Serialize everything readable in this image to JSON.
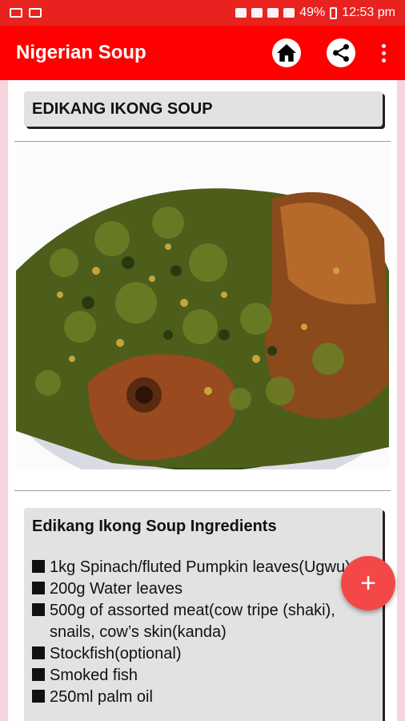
{
  "status": {
    "battery": "49%",
    "time": "12:53 pm"
  },
  "app_bar": {
    "title": "Nigerian Soup",
    "icons": [
      "home-icon",
      "share-icon",
      "more-vert-icon"
    ]
  },
  "recipe": {
    "title": "EDIKANG IKONG SOUP",
    "ingredients_heading": "Edikang Ikong Soup Ingredients",
    "ingredients": [
      "1kg Spinach/fluted Pumpkin leaves(Ugwu)",
      "200g Water leaves",
      "500g of assorted meat(cow tripe (shaki), snails, cow’s skin(kanda)",
      "Stockfish(optional)",
      "Smoked fish",
      "250ml palm oil"
    ]
  },
  "fab": {
    "label": "+"
  },
  "colors": {
    "primary": "#ff0000",
    "status_bar": "#e8231f",
    "fab": "#f44848"
  }
}
